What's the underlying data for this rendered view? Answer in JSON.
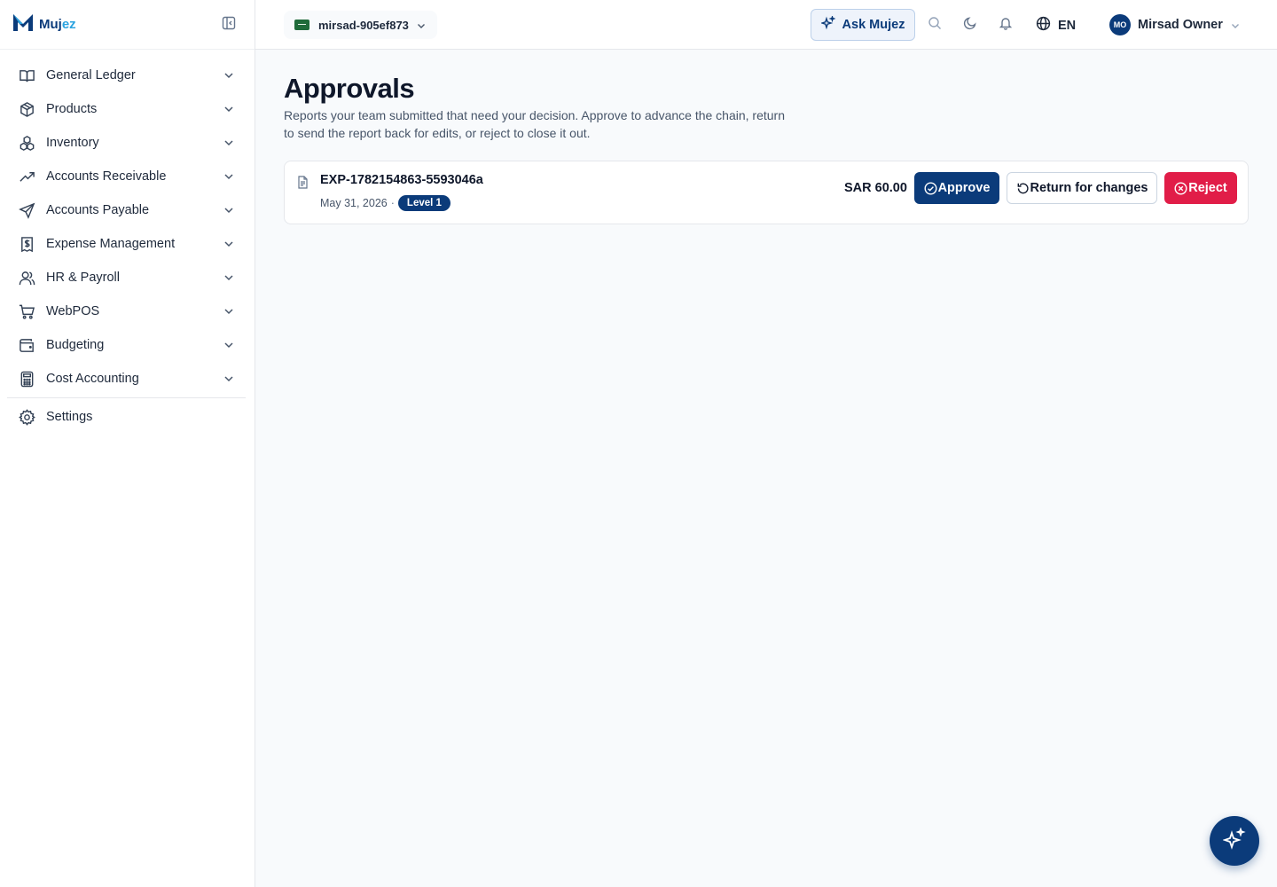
{
  "brand": {
    "name_part1": "Muj",
    "name_part2": "ez",
    "logo_icon": "mujez-logo-icon",
    "collapse_icon": "sidebar-collapse-icon"
  },
  "sidebar": {
    "items": [
      {
        "label": "General Ledger",
        "icon": "book-open-icon"
      },
      {
        "label": "Products",
        "icon": "package-icon"
      },
      {
        "label": "Inventory",
        "icon": "boxes-icon"
      },
      {
        "label": "Accounts Receivable",
        "icon": "trending-up-icon"
      },
      {
        "label": "Accounts Payable",
        "icon": "send-icon"
      },
      {
        "label": "Expense Management",
        "icon": "receipt-dollar-icon"
      },
      {
        "label": "HR & Payroll",
        "icon": "users-icon"
      },
      {
        "label": "WebPOS",
        "icon": "shopping-cart-icon"
      },
      {
        "label": "Budgeting",
        "icon": "wallet-icon"
      },
      {
        "label": "Cost Accounting",
        "icon": "calculator-icon"
      }
    ],
    "settings_label": "Settings"
  },
  "topbar": {
    "org_name": "mirsad-905ef873",
    "ask_label": "Ask Mujez",
    "language": "EN",
    "user_initials": "MO",
    "user_name": "Mirsad Owner"
  },
  "page": {
    "title": "Approvals",
    "description": "Reports your team submitted that need your decision. Approve to advance the chain, return to send the report back for edits, or reject to close it out."
  },
  "approvals": [
    {
      "report_id": "EXP-1782154863-5593046a",
      "date": "May 31, 2026",
      "separator": "·",
      "level": "Level 1",
      "amount": "SAR 60.00",
      "approve_label": "Approve",
      "return_label": "Return for changes",
      "reject_label": "Reject"
    }
  ],
  "colors": {
    "primary": "#0b3b7a",
    "accent": "#2ba3e0",
    "danger": "#e11d48"
  }
}
